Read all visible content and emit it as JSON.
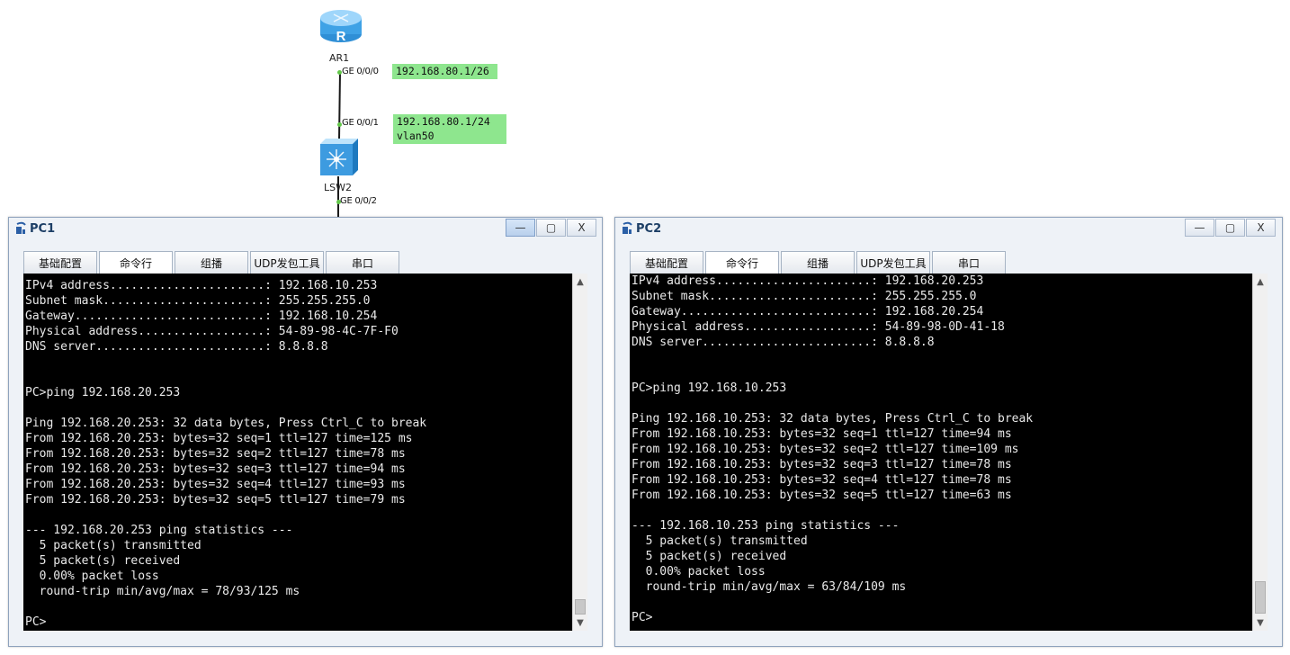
{
  "topology": {
    "router": {
      "name": "AR1",
      "port": "GE 0/0/0",
      "ip_note": "192.168.80.1/26"
    },
    "switch": {
      "name": "LSW2",
      "port_up": "GE 0/0/1",
      "port_down": "GE 0/0/2",
      "ip_note_line1": "192.168.80.1/24",
      "ip_note_line2": "vlan50"
    },
    "router_icon_letter": "R",
    "link_color": "#1a1a1a",
    "port_color": "#63c84a",
    "note_color": "#8ee68e"
  },
  "pc1": {
    "title": "PC1",
    "controls": {
      "minimize": "—",
      "maximize": "▢",
      "close": "X"
    },
    "tabs": [
      "基础配置",
      "命令行",
      "组播",
      "UDP发包工具",
      "串口"
    ],
    "active_tab": "命令行",
    "terminal_lines": [
      "IPv4 address......................: 192.168.10.253",
      "Subnet mask.......................: 255.255.255.0",
      "Gateway...........................: 192.168.10.254",
      "Physical address..................: 54-89-98-4C-7F-F0",
      "DNS server........................: 8.8.8.8",
      "",
      "",
      "PC>ping 192.168.20.253",
      "",
      "Ping 192.168.20.253: 32 data bytes, Press Ctrl_C to break",
      "From 192.168.20.253: bytes=32 seq=1 ttl=127 time=125 ms",
      "From 192.168.20.253: bytes=32 seq=2 ttl=127 time=78 ms",
      "From 192.168.20.253: bytes=32 seq=3 ttl=127 time=94 ms",
      "From 192.168.20.253: bytes=32 seq=4 ttl=127 time=93 ms",
      "From 192.168.20.253: bytes=32 seq=5 ttl=127 time=79 ms",
      "",
      "--- 192.168.20.253 ping statistics ---",
      "  5 packet(s) transmitted",
      "  5 packet(s) received",
      "  0.00% packet loss",
      "  round-trip min/avg/max = 78/93/125 ms",
      "",
      "PC>"
    ]
  },
  "pc2": {
    "title": "PC2",
    "controls": {
      "minimize": "—",
      "maximize": "▢",
      "close": "X"
    },
    "tabs": [
      "基础配置",
      "命令行",
      "组播",
      "UDP发包工具",
      "串口"
    ],
    "active_tab": "命令行",
    "terminal_lines": [
      "IPv4 address......................: 192.168.20.253",
      "Subnet mask.......................: 255.255.255.0",
      "Gateway...........................: 192.168.20.254",
      "Physical address..................: 54-89-98-0D-41-18",
      "DNS server........................: 8.8.8.8",
      "",
      "",
      "PC>ping 192.168.10.253",
      "",
      "Ping 192.168.10.253: 32 data bytes, Press Ctrl_C to break",
      "From 192.168.10.253: bytes=32 seq=1 ttl=127 time=94 ms",
      "From 192.168.10.253: bytes=32 seq=2 ttl=127 time=109 ms",
      "From 192.168.10.253: bytes=32 seq=3 ttl=127 time=78 ms",
      "From 192.168.10.253: bytes=32 seq=4 ttl=127 time=78 ms",
      "From 192.168.10.253: bytes=32 seq=5 ttl=127 time=63 ms",
      "",
      "--- 192.168.10.253 ping statistics ---",
      "  5 packet(s) transmitted",
      "  5 packet(s) received",
      "  0.00% packet loss",
      "  round-trip min/avg/max = 63/84/109 ms",
      "",
      "PC>"
    ]
  },
  "scrollbar": {
    "up_icon": "▲",
    "down_icon": "▼"
  }
}
